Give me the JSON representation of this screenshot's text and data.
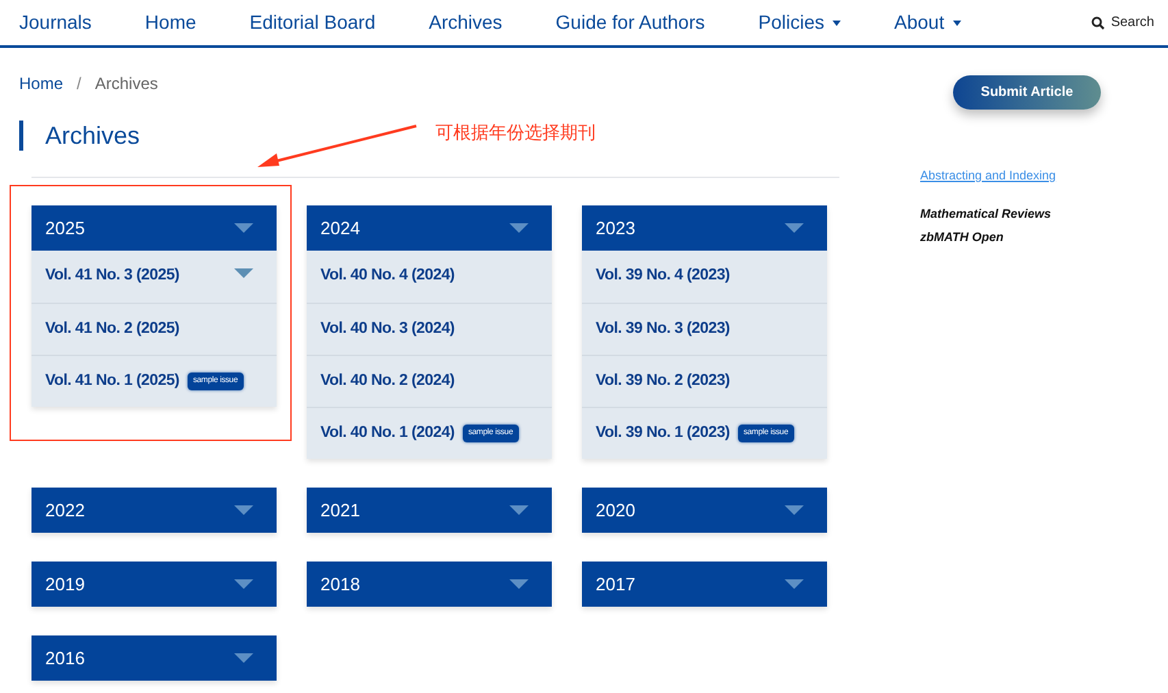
{
  "nav": {
    "items": [
      {
        "label": "Journals",
        "dropdown": false
      },
      {
        "label": "Home",
        "dropdown": false
      },
      {
        "label": "Editorial Board",
        "dropdown": false
      },
      {
        "label": "Archives",
        "dropdown": false
      },
      {
        "label": "Guide for Authors",
        "dropdown": false
      },
      {
        "label": "Policies",
        "dropdown": true
      },
      {
        "label": "About",
        "dropdown": true
      }
    ],
    "search": "Search"
  },
  "breadcrumb": {
    "items": [
      "Home",
      "Archives"
    ],
    "separator": "/"
  },
  "heading": "Archives",
  "annotation": "可根据年份选择期刊",
  "years": [
    {
      "year": "2025",
      "issues": [
        {
          "label": "Vol. 41 No. 3 (2025)",
          "caret": true
        },
        {
          "label": "Vol. 41 No. 2 (2025)",
          "caret": false
        },
        {
          "label": "Vol. 41 No. 1 (2025)",
          "caret": false,
          "badge": "sample issue"
        }
      ]
    },
    {
      "year": "2024",
      "issues": [
        {
          "label": "Vol. 40 No. 4 (2024)",
          "caret": false
        },
        {
          "label": "Vol. 40 No. 3 (2024)",
          "caret": false
        },
        {
          "label": "Vol. 40 No. 2 (2024)",
          "caret": false
        },
        {
          "label": "Vol. 40 No. 1 (2024)",
          "caret": false,
          "badge": "sample issue"
        }
      ]
    },
    {
      "year": "2023",
      "issues": [
        {
          "label": "Vol. 39 No. 4 (2023)",
          "caret": false
        },
        {
          "label": "Vol. 39 No. 3 (2023)",
          "caret": false
        },
        {
          "label": "Vol. 39 No. 2 (2023)",
          "caret": false
        },
        {
          "label": "Vol. 39 No. 1 (2023)",
          "caret": false,
          "badge": "sample issue"
        }
      ]
    },
    {
      "year": "2022"
    },
    {
      "year": "2021"
    },
    {
      "year": "2020"
    },
    {
      "year": "2019"
    },
    {
      "year": "2018"
    },
    {
      "year": "2017"
    },
    {
      "year": "2016"
    }
  ],
  "sidebar": {
    "button": "Submit Article",
    "link": "Abstracting and Indexing",
    "indexes": [
      "Mathematical Reviews",
      "zbMATH Open"
    ]
  }
}
